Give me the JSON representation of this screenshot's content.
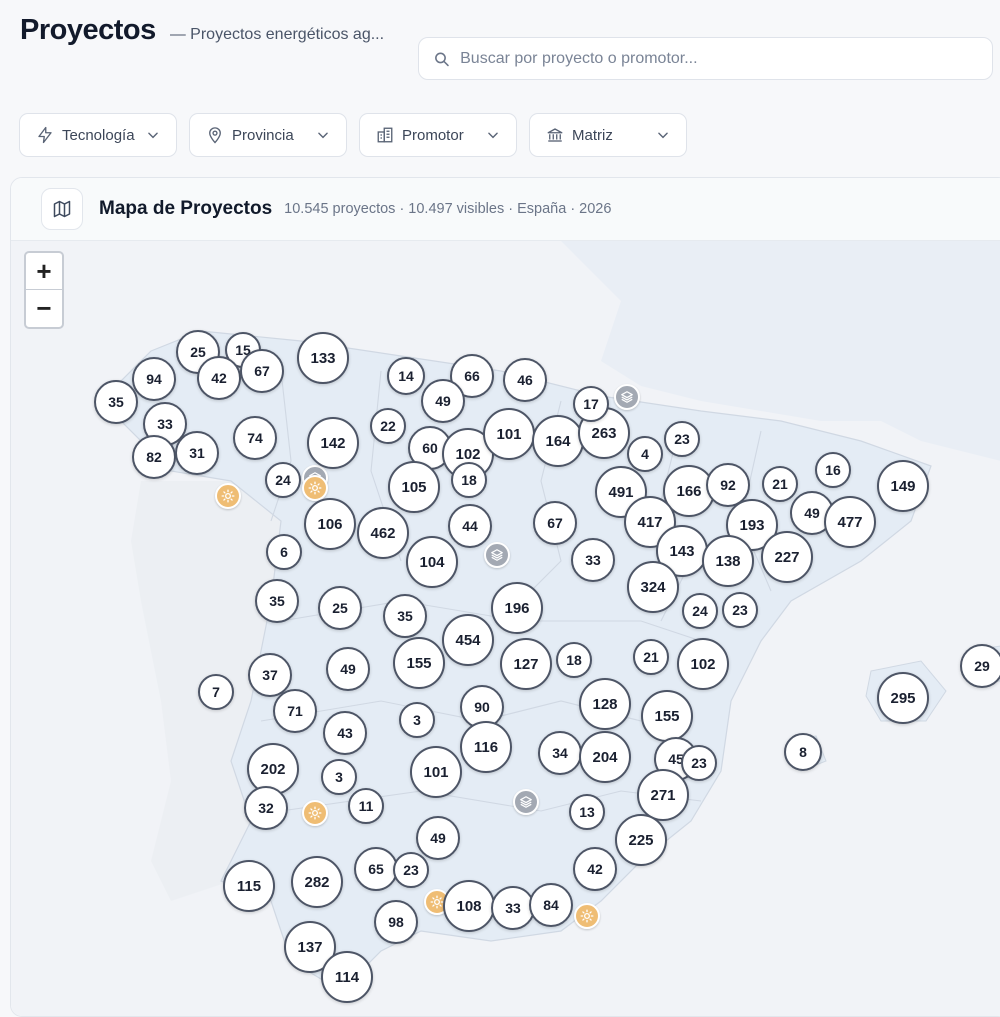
{
  "header": {
    "title": "Proyectos",
    "subtitle": "— Proyectos energéticos ag..."
  },
  "search": {
    "placeholder": "Buscar por proyecto o promotor..."
  },
  "filters": [
    {
      "label": "Tecnología",
      "icon": "bolt-icon"
    },
    {
      "label": "Provincia",
      "icon": "map-pin-icon"
    },
    {
      "label": "Promotor",
      "icon": "building-icon"
    },
    {
      "label": "Matriz",
      "icon": "bank-icon"
    }
  ],
  "map": {
    "title": "Mapa de Proyectos",
    "meta": "10.545 proyectos · 10.497 visibles · España · 2026",
    "zoom_in": "+",
    "zoom_out": "−",
    "colors": {
      "land": "#e9eef5",
      "region_fill": "#e4ecf5",
      "border": "#d0d8e3",
      "cluster_border": "#4d5566",
      "solar": "#efbd74",
      "grey_marker": "#a3a9b3"
    },
    "clusters": [
      "25",
      "15",
      "94",
      "42",
      "67",
      "133",
      "35",
      "33",
      "14",
      "66",
      "46",
      "49",
      "22",
      "74",
      "142",
      "60",
      "102",
      "101",
      "164",
      "263",
      "23",
      "82",
      "31",
      "17",
      "4",
      "24",
      "105",
      "18",
      "491",
      "166",
      "92",
      "21",
      "16",
      "149",
      "106",
      "462",
      "44",
      "67",
      "417",
      "193",
      "49",
      "477",
      "6",
      "104",
      "143",
      "138",
      "227",
      "33",
      "324",
      "35",
      "25",
      "35",
      "196",
      "454",
      "24",
      "23",
      "7",
      "37",
      "49",
      "155",
      "127",
      "18",
      "21",
      "102",
      "29",
      "295",
      "71",
      "3",
      "90",
      "128",
      "155",
      "43",
      "116",
      "202",
      "3",
      "34",
      "204",
      "45",
      "23",
      "8",
      "101",
      "271",
      "32",
      "11",
      "13",
      "49",
      "225",
      "65",
      "23",
      "42",
      "115",
      "282",
      "108",
      "33",
      "84",
      "98",
      "137",
      "114"
    ],
    "markers": [
      "solar",
      "grey",
      "solar",
      "grey",
      "grey",
      "solar",
      "grey",
      "solar",
      "solar"
    ]
  }
}
